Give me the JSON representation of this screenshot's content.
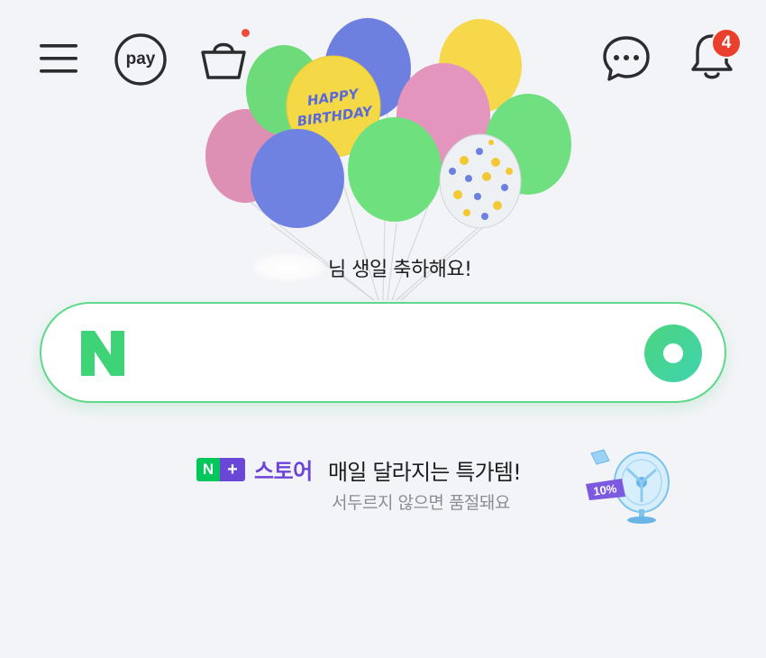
{
  "header": {
    "pay_label": "pay",
    "notification_count": "4",
    "icons": [
      "menu-icon",
      "pay-icon",
      "cart-icon",
      "talk-icon",
      "bell-icon"
    ]
  },
  "banner": {
    "greeting": "님 생일 축하해요!",
    "balloon_text_line1": "HAPPY",
    "balloon_text_line2": "BIRTHDAY"
  },
  "search": {
    "logo_letter": "N",
    "value": "",
    "placeholder": ""
  },
  "promo": {
    "badge_n": "N",
    "badge_plus": "+",
    "store_label": "스토어",
    "title": "매일 달라지는 특가템!",
    "subtitle": "서두르지 않으면 품절돼요",
    "discount_tag": "10%"
  },
  "colors": {
    "accent_green": "#03c75a",
    "store_purple": "#6a47d6",
    "badge_red": "#ea3f2d",
    "background": "#f3f4f7"
  }
}
